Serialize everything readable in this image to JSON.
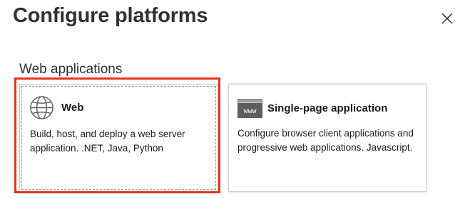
{
  "dialog": {
    "title": "Configure platforms",
    "close_icon": "close-icon"
  },
  "section": {
    "label": "Web applications"
  },
  "cards": {
    "web": {
      "name": "Web",
      "description": "Build, host, and deploy a web server application. .NET, Java, Python",
      "icon": "globe-icon"
    },
    "spa": {
      "name": "Single-page application",
      "description": "Configure browser client applications and progressive web applications. Javascript.",
      "icon": "browser-window-icon",
      "icon_text": "www"
    }
  },
  "colors": {
    "highlight": "#e8321f",
    "card_border": "#c8c8c8",
    "focus_outline": "#7aa6a8"
  }
}
